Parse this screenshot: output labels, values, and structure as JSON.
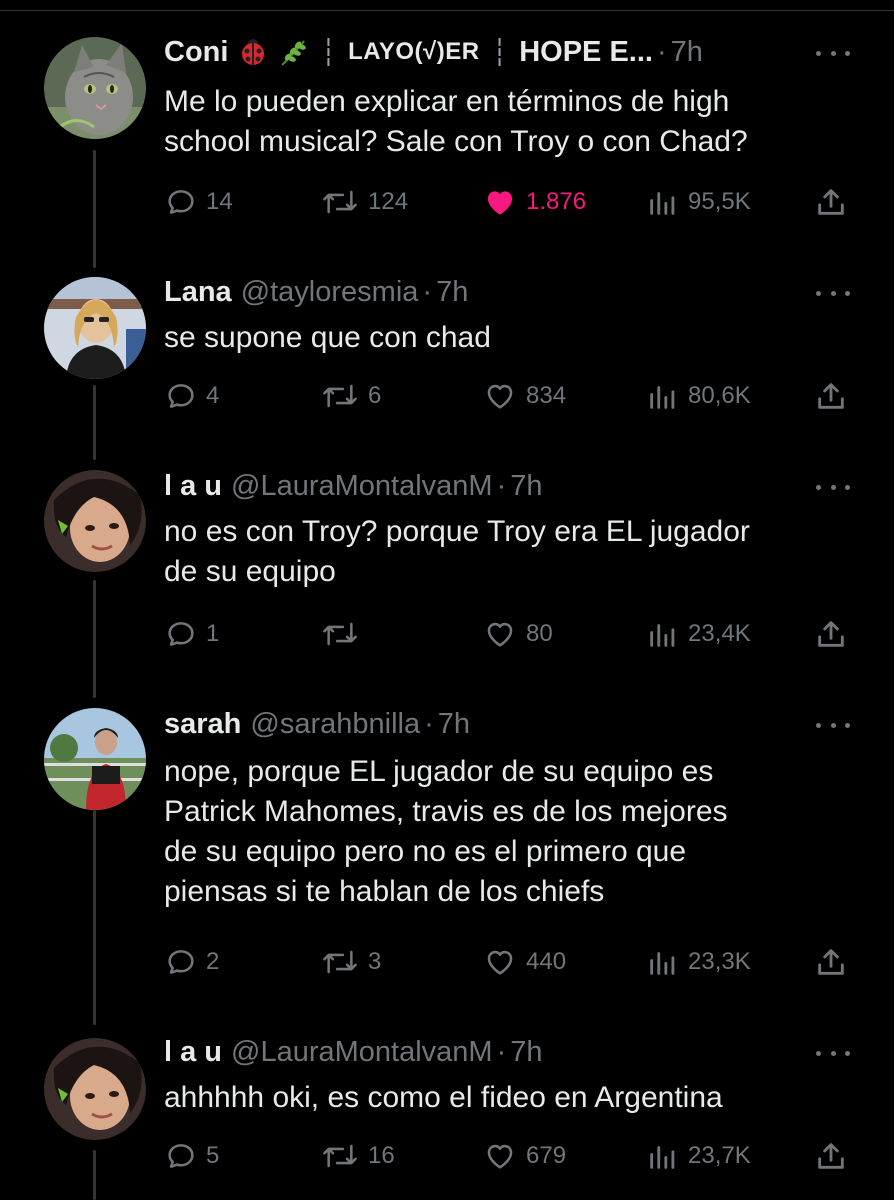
{
  "tweets": [
    {
      "name": "Coni",
      "affiliation": "LAYO(√)ER",
      "affiliation_extra": "HOPE E...",
      "time": "7h",
      "lines": [
        "Me lo pueden explicar en términos de high",
        "school musical? Sale con Troy o con Chad?"
      ],
      "replies": "14",
      "reposts": "124",
      "likes": "1.876",
      "views": "95,5K",
      "liked": true,
      "avatar": "cat-avatar"
    },
    {
      "name": "Lana",
      "handle": "@tayloresmia",
      "time": "7h",
      "lines": [
        "se supone que con chad"
      ],
      "replies": "4",
      "reposts": "6",
      "likes": "834",
      "views": "80,6K",
      "avatar": "woman-blonde-avatar"
    },
    {
      "name": "l a u",
      "handle": "@LauraMontalvanM",
      "time": "7h",
      "lines": [
        "no es con Troy? porque Troy era EL jugador",
        "de su equipo"
      ],
      "replies": "1",
      "reposts": "",
      "likes": "80",
      "views": "23,4K",
      "avatar": "girl-selfie-avatar"
    },
    {
      "name": "sarah",
      "handle": "@sarahbnilla",
      "time": "7h",
      "lines": [
        "nope, porque EL jugador de su equipo es",
        "Patrick Mahomes, travis es de los mejores",
        "de su equipo pero no es el primero que",
        "piensas si te hablan de los chiefs"
      ],
      "replies": "2",
      "reposts": "3",
      "likes": "440",
      "views": "23,3K",
      "avatar": "woman-outdoor-avatar"
    },
    {
      "name": "l a u",
      "handle": "@LauraMontalvanM",
      "time": "7h",
      "lines": [
        "ahhhhh oki, es como el fideo en Argentina"
      ],
      "replies": "5",
      "reposts": "16",
      "likes": "679",
      "views": "23,7K",
      "avatar": "girl-selfie-avatar"
    }
  ],
  "colors": {
    "background": "#000000",
    "text": "#e7e9ea",
    "muted": "#71767b",
    "like": "#f91880",
    "thread": "#333639"
  }
}
